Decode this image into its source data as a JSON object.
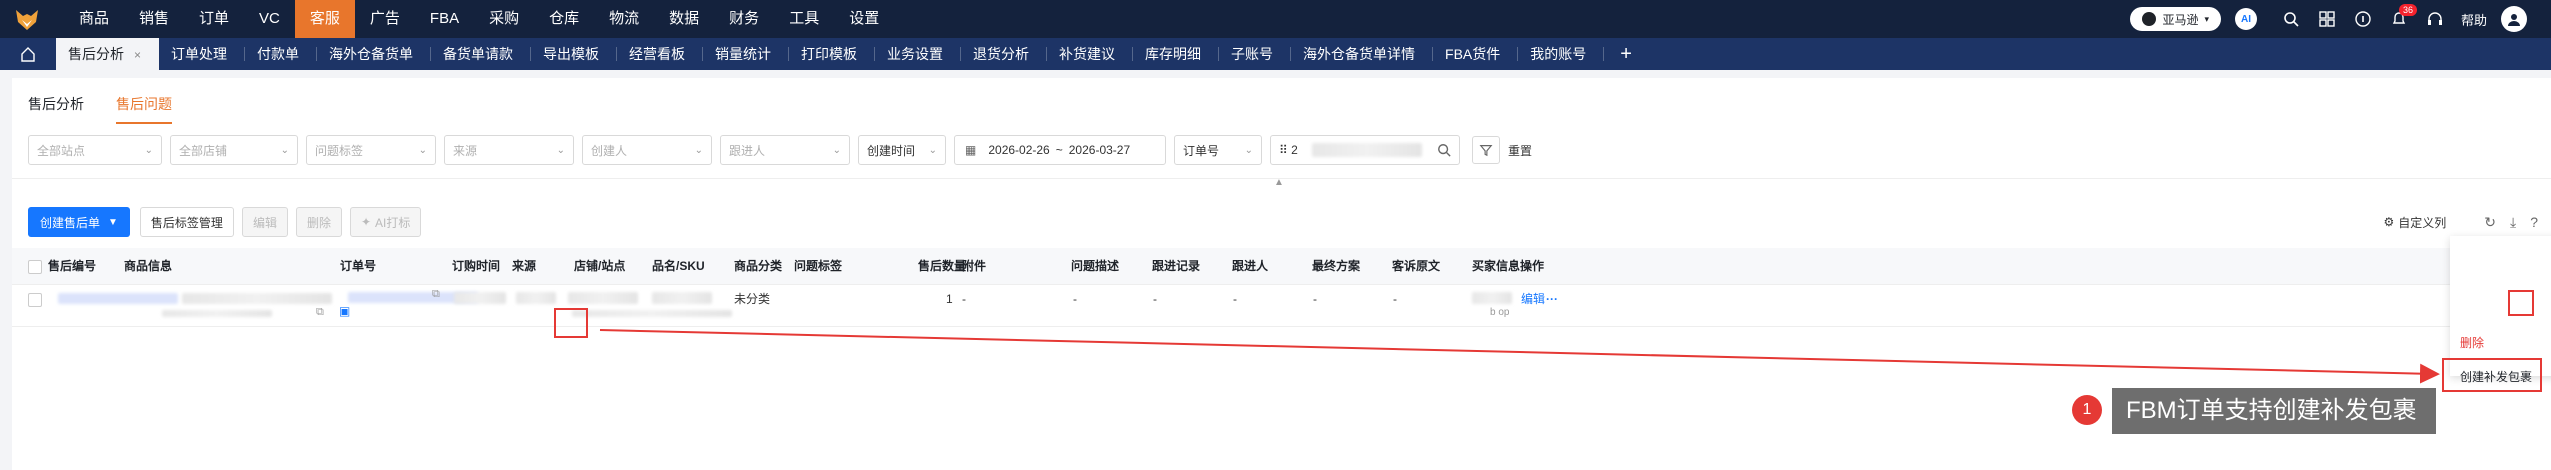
{
  "topnav": {
    "items": [
      "商品",
      "销售",
      "订单",
      "VC",
      "客服",
      "广告",
      "FBA",
      "采购",
      "仓库",
      "物流",
      "数据",
      "财务",
      "工具",
      "设置"
    ],
    "active_index": 4,
    "store_label": "亚马逊",
    "ai_label": "AI",
    "notification_count": "36",
    "help_label": "帮助"
  },
  "tabs": [
    "售后分析",
    "订单处理",
    "付款单",
    "海外仓备货单",
    "备货单请款",
    "导出模板",
    "经营看板",
    "销量统计",
    "打印模板",
    "业务设置",
    "退货分析",
    "补货建议",
    "库存明细",
    "子账号",
    "海外仓备货单详情",
    "FBA货件",
    "我的账号"
  ],
  "tab_plus": "+",
  "tab_close": "×",
  "subtabs": [
    "售后分析",
    "售后问题"
  ],
  "subtab_active": 1,
  "filters": {
    "site": "全部站点",
    "store": "全部店铺",
    "tag": "问题标签",
    "source": "来源",
    "creator": "创建人",
    "follower": "跟进人",
    "time_type": "创建时间",
    "date_start": "2026-02-26",
    "date_sep": "~",
    "date_end": "2026-03-27",
    "order_type": "订单号",
    "search_prefix": "⠿ 2",
    "reset": "重置"
  },
  "toolbar": {
    "create": "创建售后单",
    "tag_manage": "售后标签管理",
    "edit": "编辑",
    "delete": "删除",
    "ai": "AI打标",
    "custom_cols": "自定义列"
  },
  "table": {
    "headers": [
      "售后编号",
      "商品信息",
      "订单号",
      "订购时间",
      "来源",
      "店铺/站点",
      "品名/SKU",
      "商品分类",
      "问题标签",
      "售后数量",
      "附件",
      "问题描述",
      "跟进记录",
      "跟进人",
      "最终方案",
      "客诉原文",
      "买家信息",
      "操作"
    ],
    "row": {
      "category": "未分类",
      "quantity": "1",
      "attachment": "-",
      "description": "-",
      "follow_record": "-",
      "follower": "-",
      "plan": "-",
      "complaint": "-",
      "buyer_tail": "b   op",
      "edit": "编辑",
      "more": "···"
    }
  },
  "dropdown": {
    "delete": "删除",
    "create_reship": "创建补发包裹"
  },
  "annotation": {
    "number": "1",
    "text": "FBM订单支持创建补发包裹",
    "color": "#e53935"
  }
}
